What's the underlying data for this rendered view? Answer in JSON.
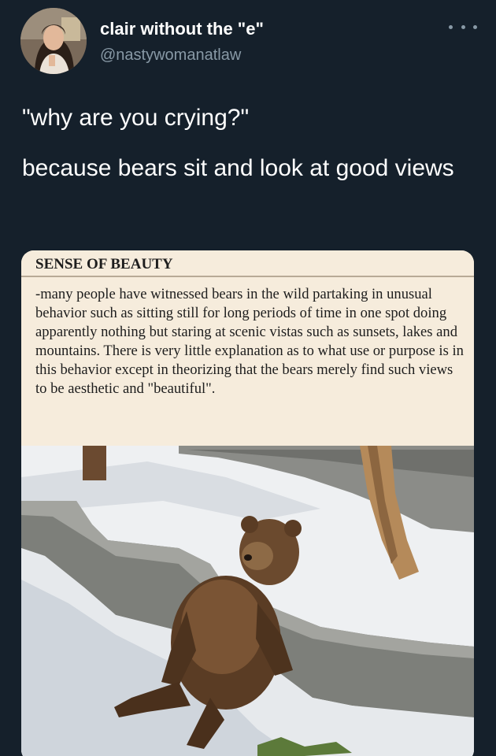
{
  "user": {
    "display_name": "clair without the \"e\"",
    "handle": "@nastywomanatlaw"
  },
  "tweet": {
    "line1": "\"why are you crying?\"",
    "line2": "because bears sit and look at good views"
  },
  "media": {
    "title": "SENSE OF BEAUTY",
    "body": "-many people have witnessed bears in the wild partaking in unusual behavior such as sitting still for long periods of time in one spot doing apparently nothing but staring at scenic vistas such as sunsets, lakes and mountains. There is very little explanation as to what use or purpose is in this behavior except in theorizing that the bears merely find such views to be aesthetic and \"beautiful\"."
  },
  "icons": {
    "more": "more-options-icon"
  },
  "colors": {
    "background": "#15202b",
    "primary_text": "#ffffff",
    "secondary_text": "#8899a6",
    "card_background": "#f6ecdc"
  }
}
